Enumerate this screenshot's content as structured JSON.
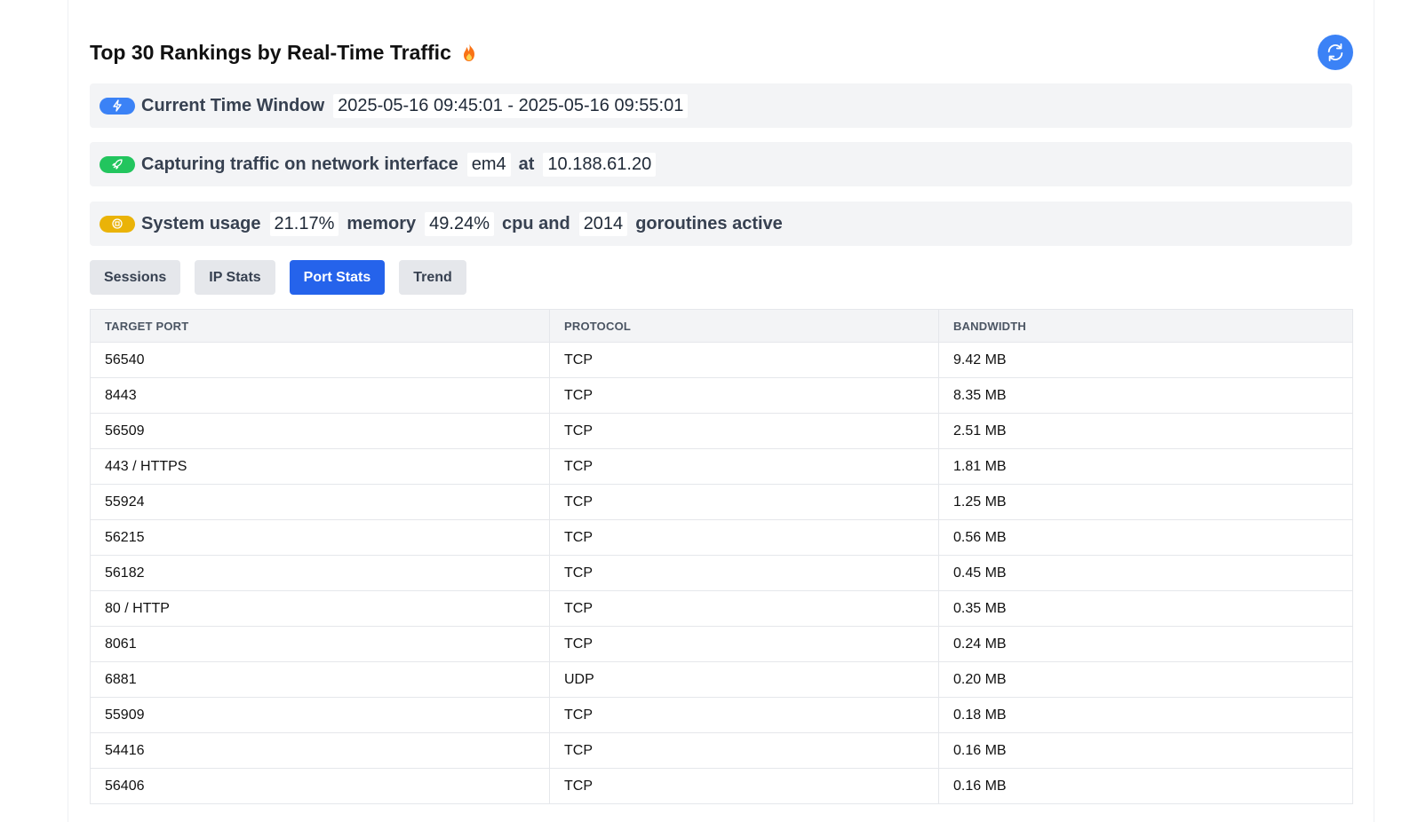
{
  "header": {
    "title": "Top 30 Rankings by Real-Time Traffic"
  },
  "time_window": {
    "label": "Current Time Window",
    "value": "2025-05-16 09:45:01 - 2025-05-16 09:55:01"
  },
  "capture": {
    "label": "Capturing traffic on network interface",
    "interface": "em4",
    "at_label": "at",
    "ip": "10.188.61.20"
  },
  "system": {
    "label": "System usage",
    "memory_value": "21.17%",
    "memory_label": "memory",
    "cpu_value": "49.24%",
    "cpu_label": "cpu and",
    "goroutines_value": "2014",
    "goroutines_label": "goroutines active"
  },
  "tabs": [
    {
      "label": "Sessions",
      "active": false
    },
    {
      "label": "IP Stats",
      "active": false
    },
    {
      "label": "Port Stats",
      "active": true
    },
    {
      "label": "Trend",
      "active": false
    }
  ],
  "table": {
    "columns": [
      "TARGET PORT",
      "PROTOCOL",
      "BANDWIDTH"
    ],
    "rows": [
      [
        "56540",
        "TCP",
        "9.42 MB"
      ],
      [
        "8443",
        "TCP",
        "8.35 MB"
      ],
      [
        "56509",
        "TCP",
        "2.51 MB"
      ],
      [
        "443 / HTTPS",
        "TCP",
        "1.81 MB"
      ],
      [
        "55924",
        "TCP",
        "1.25 MB"
      ],
      [
        "56215",
        "TCP",
        "0.56 MB"
      ],
      [
        "56182",
        "TCP",
        "0.45 MB"
      ],
      [
        "80 / HTTP",
        "TCP",
        "0.35 MB"
      ],
      [
        "8061",
        "TCP",
        "0.24 MB"
      ],
      [
        "6881",
        "UDP",
        "0.20 MB"
      ],
      [
        "55909",
        "TCP",
        "0.18 MB"
      ],
      [
        "54416",
        "TCP",
        "0.16 MB"
      ],
      [
        "56406",
        "TCP",
        "0.16 MB"
      ]
    ]
  },
  "colors": {
    "accent": "#2563eb",
    "refresh": "#3b82f6",
    "pill_blue": "#3b82f6",
    "pill_green": "#22c55e",
    "pill_yellow": "#eab308",
    "flame": "#f97316"
  },
  "icons": {
    "title": "flame-icon",
    "refresh": "refresh-icon",
    "time_window": "lightning-icon",
    "capture": "rocket-icon",
    "system": "cpu-icon"
  }
}
